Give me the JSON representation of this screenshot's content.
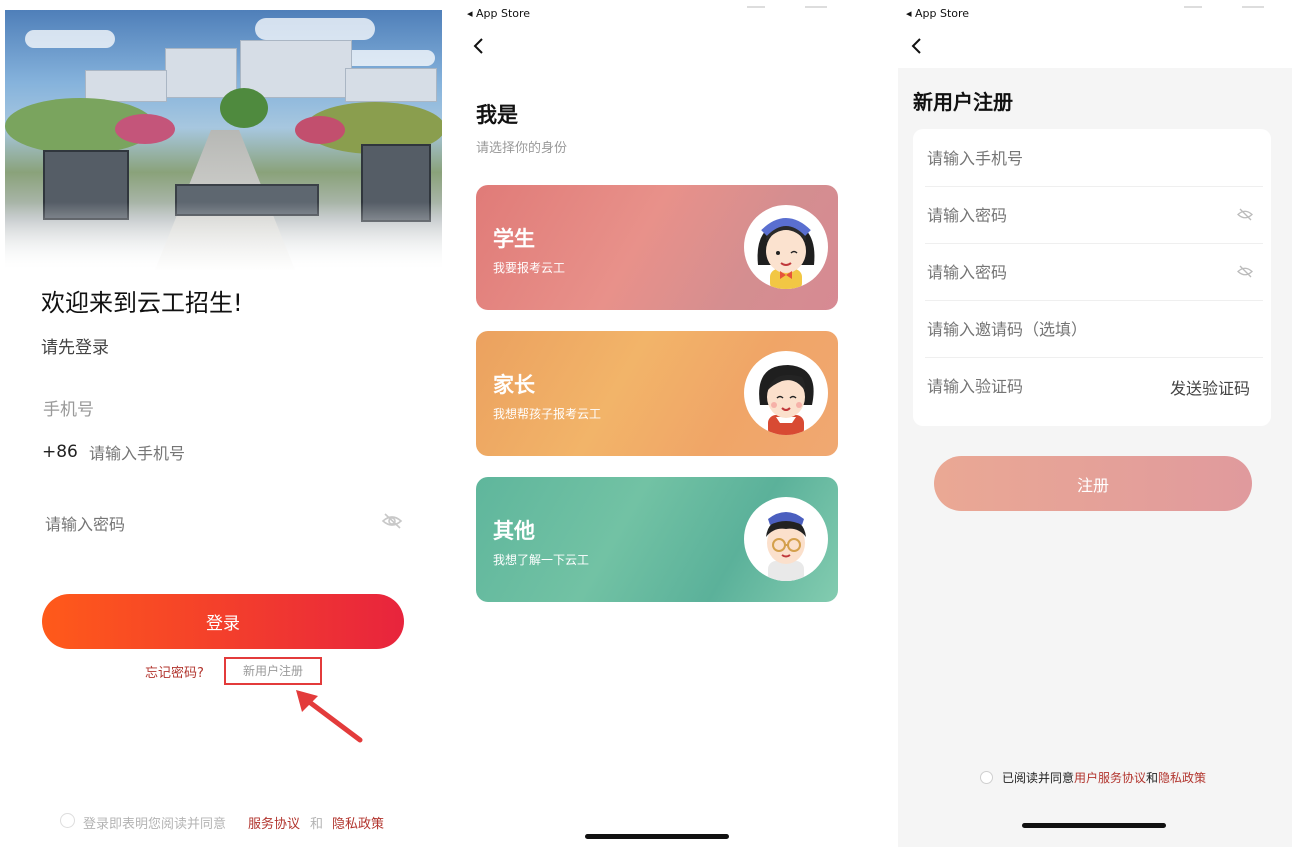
{
  "login": {
    "welcome": "欢迎来到云工招生!",
    "subtitle": "请先登录",
    "phone_label": "手机号",
    "country_code": "+86",
    "phone_placeholder": "请输入手机号",
    "password_placeholder": "请输入密码",
    "login_button": "登录",
    "forgot_password": "忘记密码?",
    "register_link": "新用户注册",
    "agreement_prefix": "登录即表明您阅读并同意",
    "service_agreement": "服务协议",
    "and": "和",
    "privacy_policy": "隐私政策",
    "highlight_color": "#e33b3b"
  },
  "identity": {
    "status_back": "◂ App Store",
    "title": "我是",
    "subtitle": "请选择你的身份",
    "options": [
      {
        "name": "学生",
        "desc": "我要报考云工",
        "icon": "student-avatar-icon"
      },
      {
        "name": "家长",
        "desc": "我想帮孩子报考云工",
        "icon": "parent-avatar-icon"
      },
      {
        "name": "其他",
        "desc": "我想了解一下云工",
        "icon": "other-avatar-icon"
      }
    ]
  },
  "register": {
    "status_back": "◂ App Store",
    "title": "新用户注册",
    "phone_placeholder": "请输入手机号",
    "password_placeholder": "请输入密码",
    "confirm_password_placeholder": "请输入密码",
    "invite_placeholder": "请输入邀请码（选填）",
    "code_placeholder": "请输入验证码",
    "send_code": "发送验证码",
    "submit": "注册",
    "agree_prefix": "已阅读并同意",
    "user_agreement": "用户服务协议",
    "and": "和",
    "privacy_policy": "隐私政策"
  }
}
